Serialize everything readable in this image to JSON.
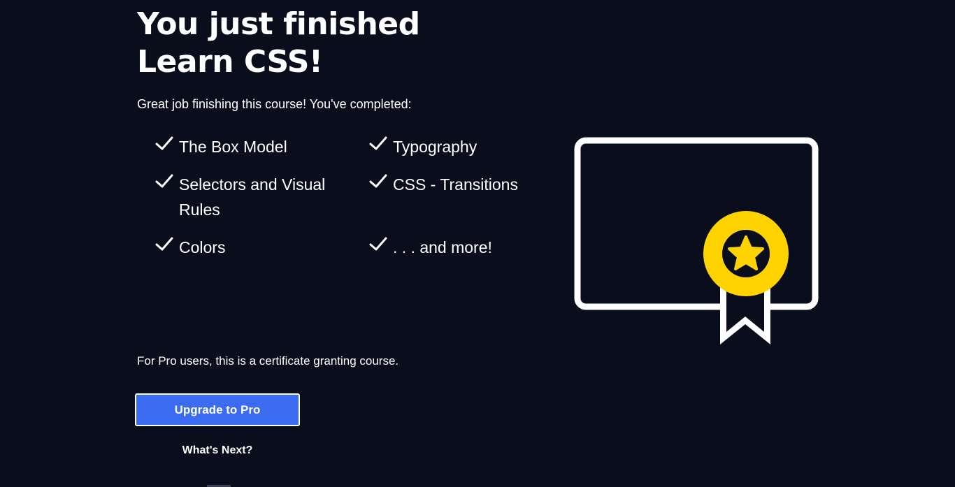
{
  "header": {
    "title_line1": "You just finished",
    "title_line2": "Learn CSS!"
  },
  "intro": "Great job finishing this course! You've completed:",
  "topics": [
    {
      "label": "The Box Model",
      "icon": "checkmark-icon"
    },
    {
      "label": "Typography",
      "icon": "checkmark-icon"
    },
    {
      "label": "Selectors and Visual Rules",
      "icon": "checkmark-icon"
    },
    {
      "label": "CSS - Transitions",
      "icon": "checkmark-icon"
    },
    {
      "label": "Colors",
      "icon": "checkmark-icon"
    },
    {
      "label": ". . . and more!",
      "icon": "checkmark-icon"
    }
  ],
  "certificate": {
    "icon": "certificate-icon",
    "badge_icon": "star-badge-icon",
    "badge_color": "#ffd300",
    "frame_color": "#ffffff"
  },
  "pro_note": "For Pro users, this is a certificate granting course.",
  "actions": {
    "upgrade_label": "Upgrade to Pro",
    "next_label": "What's Next?"
  },
  "colors": {
    "background": "#0a0d1c",
    "accent": "#3a6bf0",
    "text": "#ffffff"
  }
}
